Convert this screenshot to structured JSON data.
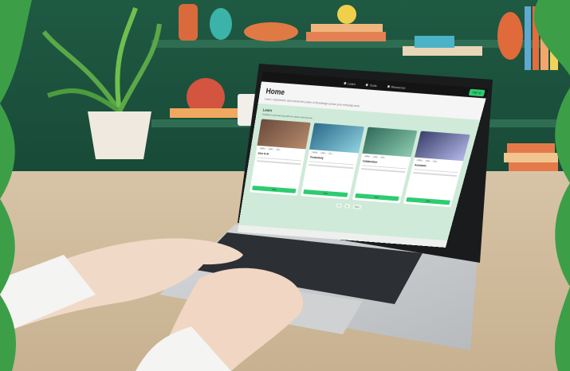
{
  "scene": {
    "frame_color": "#3c9f48",
    "description_icons": [
      "plant-icon",
      "vase-icon",
      "books-icon",
      "laptop-icon"
    ]
  },
  "screen": {
    "nav_tabs": [
      {
        "label": "Learn",
        "icon": "book-icon"
      },
      {
        "label": "Tools",
        "icon": "wrench-icon"
      },
      {
        "label": "Resources",
        "icon": "folder-icon"
      }
    ],
    "signup_label": "Sign up",
    "page_title": "Home",
    "page_subtitle": "Learn, experiment, and unlock the power of knowledge across your everyday work",
    "section_title": "Learn",
    "section_subtitle": "Guidance and learning paths for faster learning use",
    "cards": [
      {
        "title": "Intro to AI",
        "chips": [
          "video",
          "new",
          "5m"
        ],
        "button": "Start"
      },
      {
        "title": "Productivity",
        "chips": [
          "video",
          "new",
          "7m"
        ],
        "button": "Start"
      },
      {
        "title": "Collaboration",
        "chips": [
          "video",
          "new",
          "9m"
        ],
        "button": "Start"
      },
      {
        "title": "Assistants",
        "chips": [
          "video",
          "new",
          "6m"
        ],
        "button": "Start"
      }
    ],
    "pager": [
      "1",
      "2",
      "Next"
    ]
  }
}
